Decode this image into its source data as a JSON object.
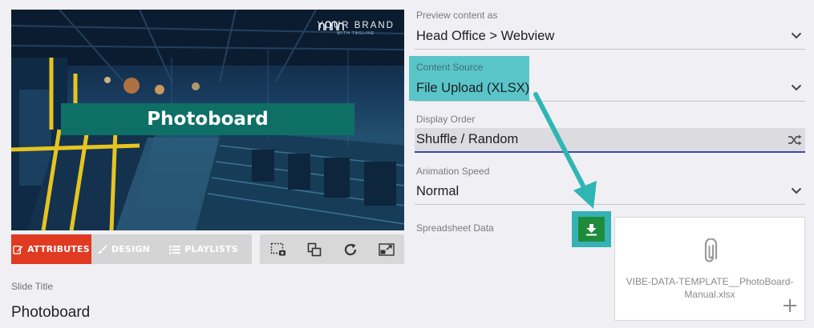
{
  "preview": {
    "brand_name": "YOUR BRAND",
    "brand_tagline": "WITH TAGLINE",
    "banner_title": "Photoboard"
  },
  "tabs": [
    {
      "label": "ATTRIBUTES",
      "icon": "edit-icon",
      "active": true
    },
    {
      "label": "DESIGN",
      "icon": "brush-icon",
      "active": false
    },
    {
      "label": "PLAYLISTS",
      "icon": "list-icon",
      "active": false
    }
  ],
  "tools": [
    "screenshot-icon",
    "layers-icon",
    "refresh-icon",
    "resize-icon"
  ],
  "slide_title": {
    "label": "Slide Title",
    "value": "Photoboard"
  },
  "form": {
    "preview_as": {
      "label": "Preview content as",
      "value": "Head Office > Webview"
    },
    "content_source": {
      "label": "Content Source",
      "value": "File Upload (XLSX)"
    },
    "display_order": {
      "label": "Display Order",
      "value": "Shuffle / Random"
    },
    "animation_speed": {
      "label": "Animation Speed",
      "value": "Normal"
    },
    "spreadsheet": {
      "label": "Spreadsheet Data",
      "file_name": "VIBE-DATA-TEMPLATE__PhotoBoard-Manual.xlsx"
    }
  },
  "colors": {
    "accent_red": "#e03a22",
    "banner_teal": "#0e6f66",
    "highlight_cyan": "#5ac5c9",
    "download_green": "#1e8b3a",
    "focus_blue": "#3a4aa6"
  }
}
